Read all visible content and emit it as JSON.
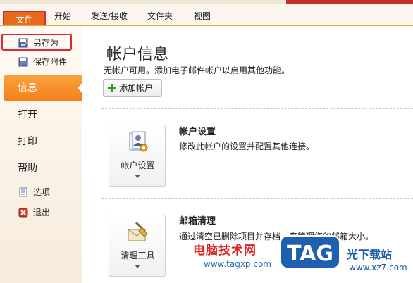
{
  "ribbon": {
    "tabs": [
      {
        "label": "文件"
      },
      {
        "label": "开始"
      },
      {
        "label": "发送/接收"
      },
      {
        "label": "文件夹"
      },
      {
        "label": "视图"
      }
    ]
  },
  "nav": {
    "save_as": "另存为",
    "save_attachments": "保存附件",
    "info": "信息",
    "open": "打开",
    "print": "打印",
    "help": "帮助",
    "options": "选项",
    "exit": "退出"
  },
  "main": {
    "title": "帐户信息",
    "subtitle": "无帐户可用。添加电子邮件帐户以启用其他功能。",
    "add_account": "添加帐户",
    "account_settings": {
      "tile_label": "帐户设置",
      "heading": "帐户设置",
      "description": "修改此帐户的设置并配置其他连接。"
    },
    "mailbox_cleanup": {
      "tile_label": "清理工具",
      "heading": "邮箱清理",
      "description": "通过清空已删除项目并存档，来管理您的邮箱大小。"
    }
  },
  "watermark": {
    "text": "电脑技术网",
    "url": "www.tagxp.com",
    "logo_text": "TAG",
    "site_name": "光下载站",
    "site_url": "www.xz7.com"
  },
  "colors": {
    "file_tab": "#e56a1c",
    "active_nav": "#f47f1b",
    "highlight_box": "#e32636",
    "watermark_red": "#e02020",
    "watermark_blue": "#1a5aa8"
  }
}
